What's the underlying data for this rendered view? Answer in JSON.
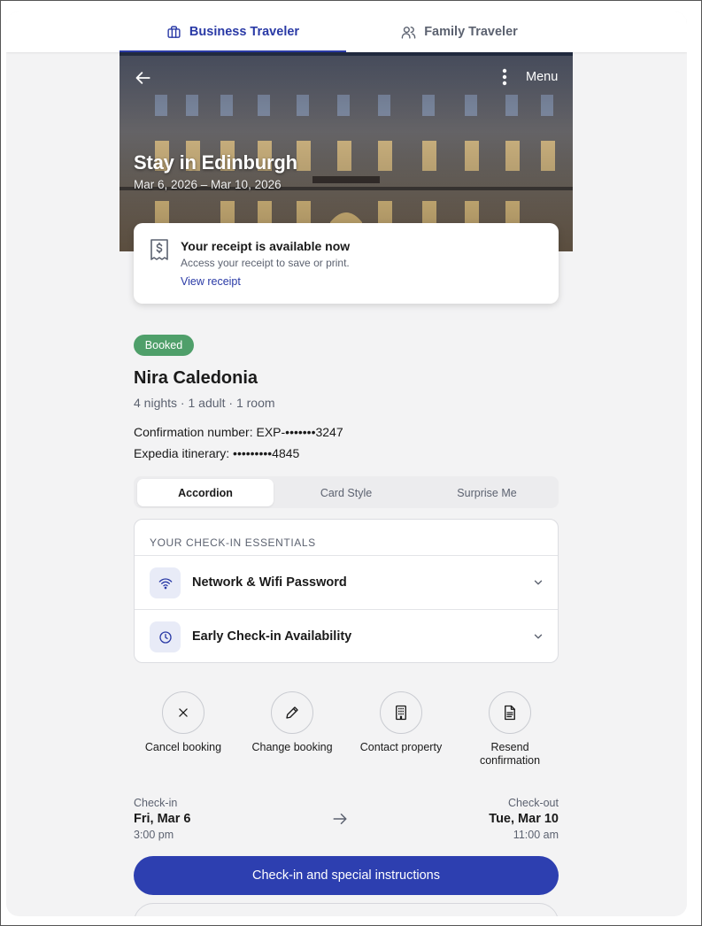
{
  "traveler_tabs": [
    {
      "label": "Business Traveler",
      "icon": "briefcase-icon",
      "active": true
    },
    {
      "label": "Family Traveler",
      "icon": "users-icon",
      "active": false
    }
  ],
  "hero": {
    "title": "Stay in Edinburgh",
    "dates": "Mar 6, 2026 – Mar 10, 2026",
    "menu_label": "Menu"
  },
  "receipt": {
    "title": "Your receipt is available now",
    "subtitle": "Access your receipt to save or print.",
    "link": "View receipt"
  },
  "booking": {
    "status": "Booked",
    "hotel_name": "Nira Caledonia",
    "summary": "4 nights · 1 adult · 1 room",
    "confirmation": "Confirmation number: EXP-•••••••3247",
    "itinerary": "Expedia itinerary: •••••••••4845"
  },
  "view_tabs": [
    {
      "label": "Accordion",
      "active": true
    },
    {
      "label": "Card Style",
      "active": false
    },
    {
      "label": "Surprise Me",
      "active": false
    }
  ],
  "essentials": {
    "header": "YOUR CHECK-IN ESSENTIALS",
    "items": [
      {
        "label": "Network & Wifi Password",
        "icon": "wifi-icon"
      },
      {
        "label": "Early Check-in Availability",
        "icon": "clock-icon"
      }
    ]
  },
  "actions": [
    {
      "label": "Cancel booking",
      "icon": "close-icon"
    },
    {
      "label": "Change booking",
      "icon": "pencil-icon"
    },
    {
      "label": "Contact property",
      "icon": "building-icon"
    },
    {
      "label": "Resend confirmation",
      "icon": "document-icon"
    }
  ],
  "checkin": {
    "label": "Check-in",
    "day": "Fri, Mar 6",
    "time": "3:00 pm"
  },
  "checkout": {
    "label": "Check-out",
    "day": "Tue, Mar 10",
    "time": "11:00 am"
  },
  "primary_button": "Check-in and special instructions",
  "colors": {
    "accent": "#2d3fb0",
    "badge": "#4f9f6a",
    "background": "#f3f3f4"
  }
}
